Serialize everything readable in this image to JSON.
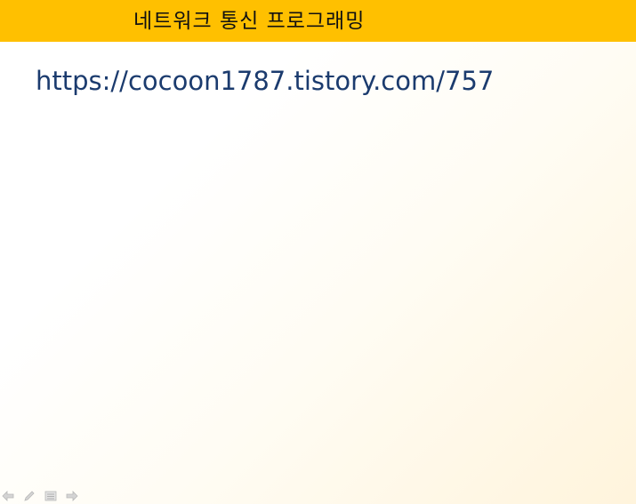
{
  "slide": {
    "title": "네트워크 통신 프로그래밍",
    "link": "https://cocoon1787.tistory.com/757"
  },
  "colors": {
    "title_bar": "#ffc000",
    "title_text": "#111111",
    "link_text": "#1b3b6e",
    "nav_icons": "#c8c8c8"
  },
  "nav_controls": {
    "icons": [
      "arrow-left-icon",
      "pen-icon",
      "menu-icon",
      "arrow-right-icon"
    ]
  }
}
